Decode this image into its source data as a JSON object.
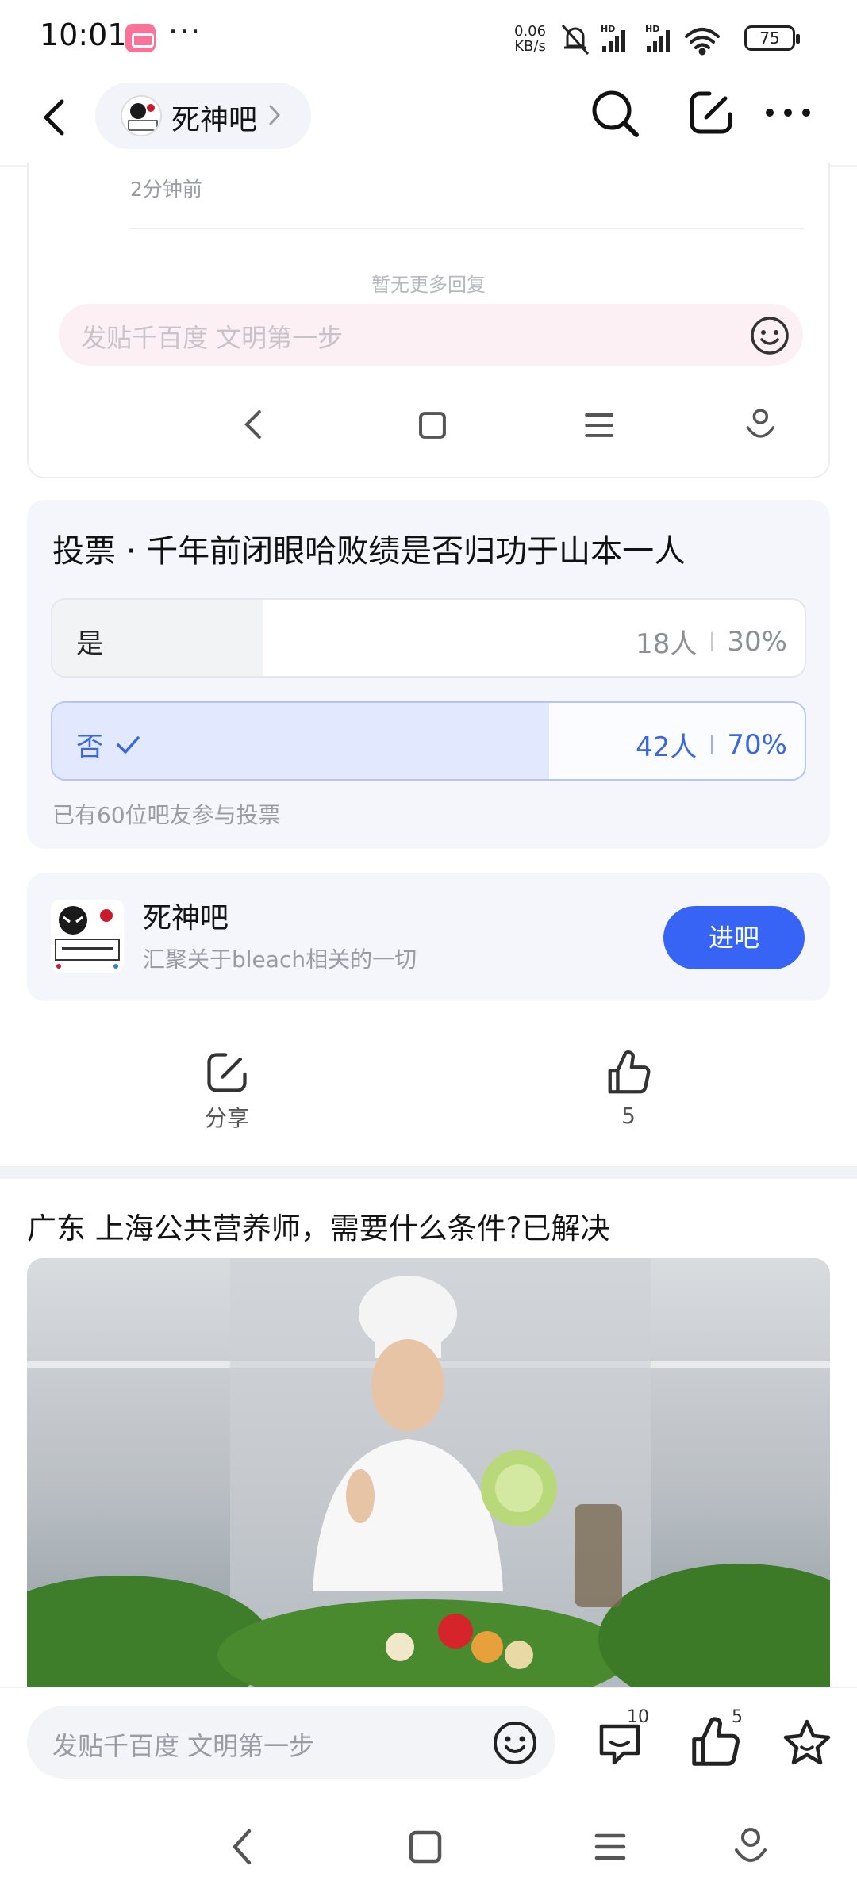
{
  "status_bar": {
    "time": "10:01",
    "overflow_dots": "···",
    "net_speed_value": "0.06",
    "net_speed_unit": "KB/s",
    "battery": "75",
    "icons": [
      "bilibili-app-icon",
      "mute-bell-icon",
      "hd-signal-icon",
      "hd-signal-icon",
      "wifi-icon",
      "battery-icon"
    ]
  },
  "header": {
    "forum_name": "死神吧",
    "icons": [
      "back-arrow-icon",
      "search-icon",
      "edit-icon",
      "more-icon"
    ]
  },
  "embed": {
    "time": "2分钟前",
    "no_more": "暂无更多回复",
    "input_placeholder": "发贴千百度 文明第一步"
  },
  "vote": {
    "title": "投票 · 千年前闭眼哈败绩是否归功于山本一人",
    "options": [
      {
        "label": "是",
        "people": "18人",
        "percent": "30%",
        "selected": false
      },
      {
        "label": "否",
        "people": "42人",
        "percent": "70%",
        "selected": true
      }
    ],
    "participants": "已有60位吧友参与投票"
  },
  "forum_card": {
    "name": "死神吧",
    "desc": "汇聚关于bleach相关的一切",
    "enter_label": "进吧"
  },
  "actions": {
    "share_label": "分享",
    "like_count": "5"
  },
  "recommend": {
    "title": "广东 上海公共营养师，需要什么条件?已解决"
  },
  "bottom_bar": {
    "input_placeholder": "发贴千百度 文明第一步",
    "comment_count": "10",
    "like_count": "5"
  },
  "colors": {
    "accent": "#3864f6",
    "vote_selected": "#3a66df",
    "card_bg": "#f5f6fb"
  }
}
